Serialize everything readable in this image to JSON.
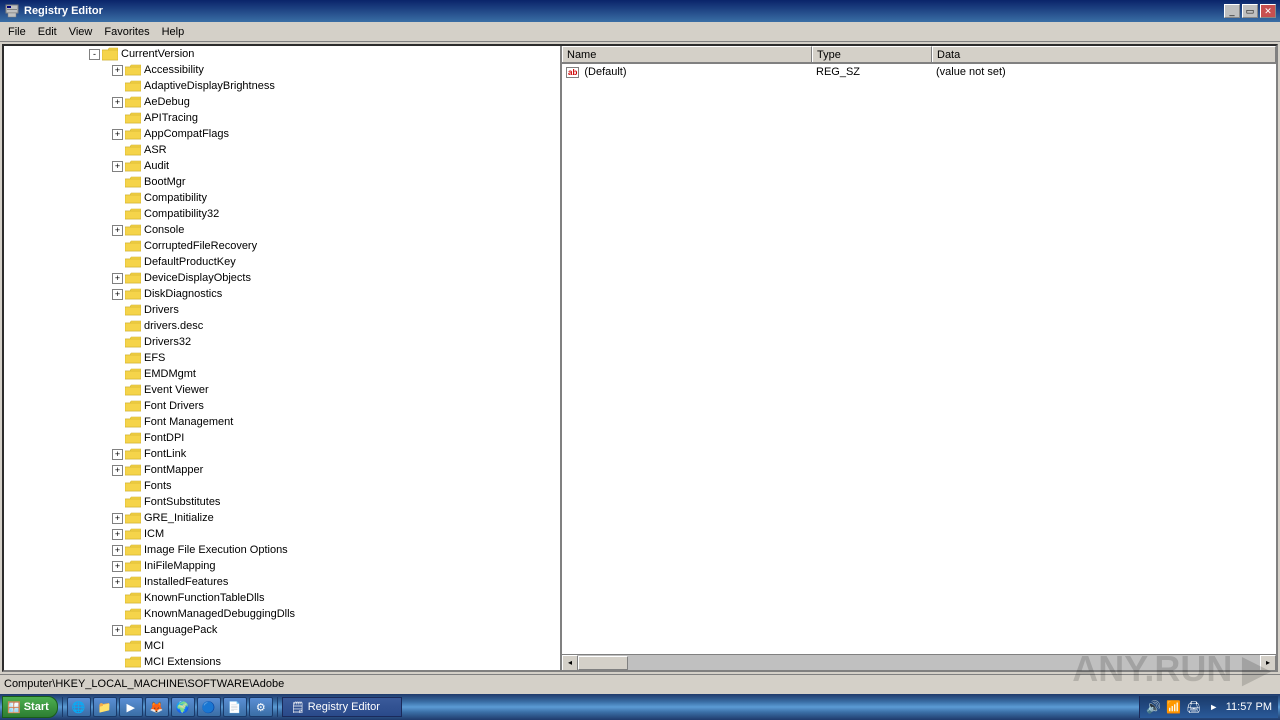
{
  "window": {
    "title": "Registry Editor",
    "title_icon": "🗒"
  },
  "menu": {
    "items": [
      "File",
      "Edit",
      "View",
      "Favorites",
      "Help"
    ]
  },
  "tree": {
    "currentVersion_label": "CurrentVersion",
    "items": [
      {
        "label": "Accessibility",
        "indent": 2,
        "has_expand": true,
        "expanded": false
      },
      {
        "label": "AdaptiveDisplayBrightness",
        "indent": 2,
        "has_expand": false,
        "expanded": false
      },
      {
        "label": "AeDebug",
        "indent": 2,
        "has_expand": true,
        "expanded": false
      },
      {
        "label": "APITracing",
        "indent": 2,
        "has_expand": false,
        "expanded": false
      },
      {
        "label": "AppCompatFlags",
        "indent": 2,
        "has_expand": true,
        "expanded": false
      },
      {
        "label": "ASR",
        "indent": 2,
        "has_expand": false,
        "expanded": false
      },
      {
        "label": "Audit",
        "indent": 2,
        "has_expand": true,
        "expanded": false
      },
      {
        "label": "BootMgr",
        "indent": 2,
        "has_expand": false,
        "expanded": false
      },
      {
        "label": "Compatibility",
        "indent": 2,
        "has_expand": false,
        "expanded": false
      },
      {
        "label": "Compatibility32",
        "indent": 2,
        "has_expand": false,
        "expanded": false
      },
      {
        "label": "Console",
        "indent": 2,
        "has_expand": true,
        "expanded": false
      },
      {
        "label": "CorruptedFileRecovery",
        "indent": 2,
        "has_expand": false,
        "expanded": false
      },
      {
        "label": "DefaultProductKey",
        "indent": 2,
        "has_expand": false,
        "expanded": false
      },
      {
        "label": "DeviceDisplayObjects",
        "indent": 2,
        "has_expand": true,
        "expanded": false
      },
      {
        "label": "DiskDiagnostics",
        "indent": 2,
        "has_expand": true,
        "expanded": false
      },
      {
        "label": "Drivers",
        "indent": 2,
        "has_expand": false,
        "expanded": false
      },
      {
        "label": "drivers.desc",
        "indent": 2,
        "has_expand": false,
        "expanded": false
      },
      {
        "label": "Drivers32",
        "indent": 2,
        "has_expand": false,
        "expanded": false
      },
      {
        "label": "EFS",
        "indent": 2,
        "has_expand": false,
        "expanded": false
      },
      {
        "label": "EMDMgmt",
        "indent": 2,
        "has_expand": false,
        "expanded": false
      },
      {
        "label": "Event Viewer",
        "indent": 2,
        "has_expand": false,
        "expanded": false
      },
      {
        "label": "Font Drivers",
        "indent": 2,
        "has_expand": false,
        "expanded": false
      },
      {
        "label": "Font Management",
        "indent": 2,
        "has_expand": false,
        "expanded": false
      },
      {
        "label": "FontDPI",
        "indent": 2,
        "has_expand": false,
        "expanded": false
      },
      {
        "label": "FontLink",
        "indent": 2,
        "has_expand": true,
        "expanded": false
      },
      {
        "label": "FontMapper",
        "indent": 2,
        "has_expand": true,
        "expanded": false
      },
      {
        "label": "Fonts",
        "indent": 2,
        "has_expand": false,
        "expanded": false
      },
      {
        "label": "FontSubstitutes",
        "indent": 2,
        "has_expand": false,
        "expanded": false
      },
      {
        "label": "GRE_Initialize",
        "indent": 2,
        "has_expand": true,
        "expanded": false
      },
      {
        "label": "ICM",
        "indent": 2,
        "has_expand": true,
        "expanded": false
      },
      {
        "label": "Image File Execution Options",
        "indent": 2,
        "has_expand": true,
        "expanded": false
      },
      {
        "label": "IniFileMapping",
        "indent": 2,
        "has_expand": true,
        "expanded": false
      },
      {
        "label": "InstalledFeatures",
        "indent": 2,
        "has_expand": true,
        "expanded": false
      },
      {
        "label": "KnownFunctionTableDlls",
        "indent": 2,
        "has_expand": false,
        "expanded": false
      },
      {
        "label": "KnownManagedDebuggingDlls",
        "indent": 2,
        "has_expand": false,
        "expanded": false
      },
      {
        "label": "LanguagePack",
        "indent": 2,
        "has_expand": true,
        "expanded": false
      },
      {
        "label": "MCI",
        "indent": 2,
        "has_expand": false,
        "expanded": false
      },
      {
        "label": "MCI Extensions",
        "indent": 2,
        "has_expand": false,
        "expanded": false
      }
    ]
  },
  "table": {
    "columns": [
      "Name",
      "Type",
      "Data"
    ],
    "rows": [
      {
        "name": "(Default)",
        "type": "REG_SZ",
        "data": "(value not set)",
        "icon": "ab"
      }
    ]
  },
  "status_bar": {
    "path": "Computer\\HKEY_LOCAL_MACHINE\\SOFTWARE\\Adobe"
  },
  "taskbar": {
    "start_label": "Start",
    "active_window": "Registry Editor",
    "clock": "11:57 PM",
    "tray_icons": [
      "🔊",
      "📶",
      "🖨",
      "➤"
    ]
  }
}
